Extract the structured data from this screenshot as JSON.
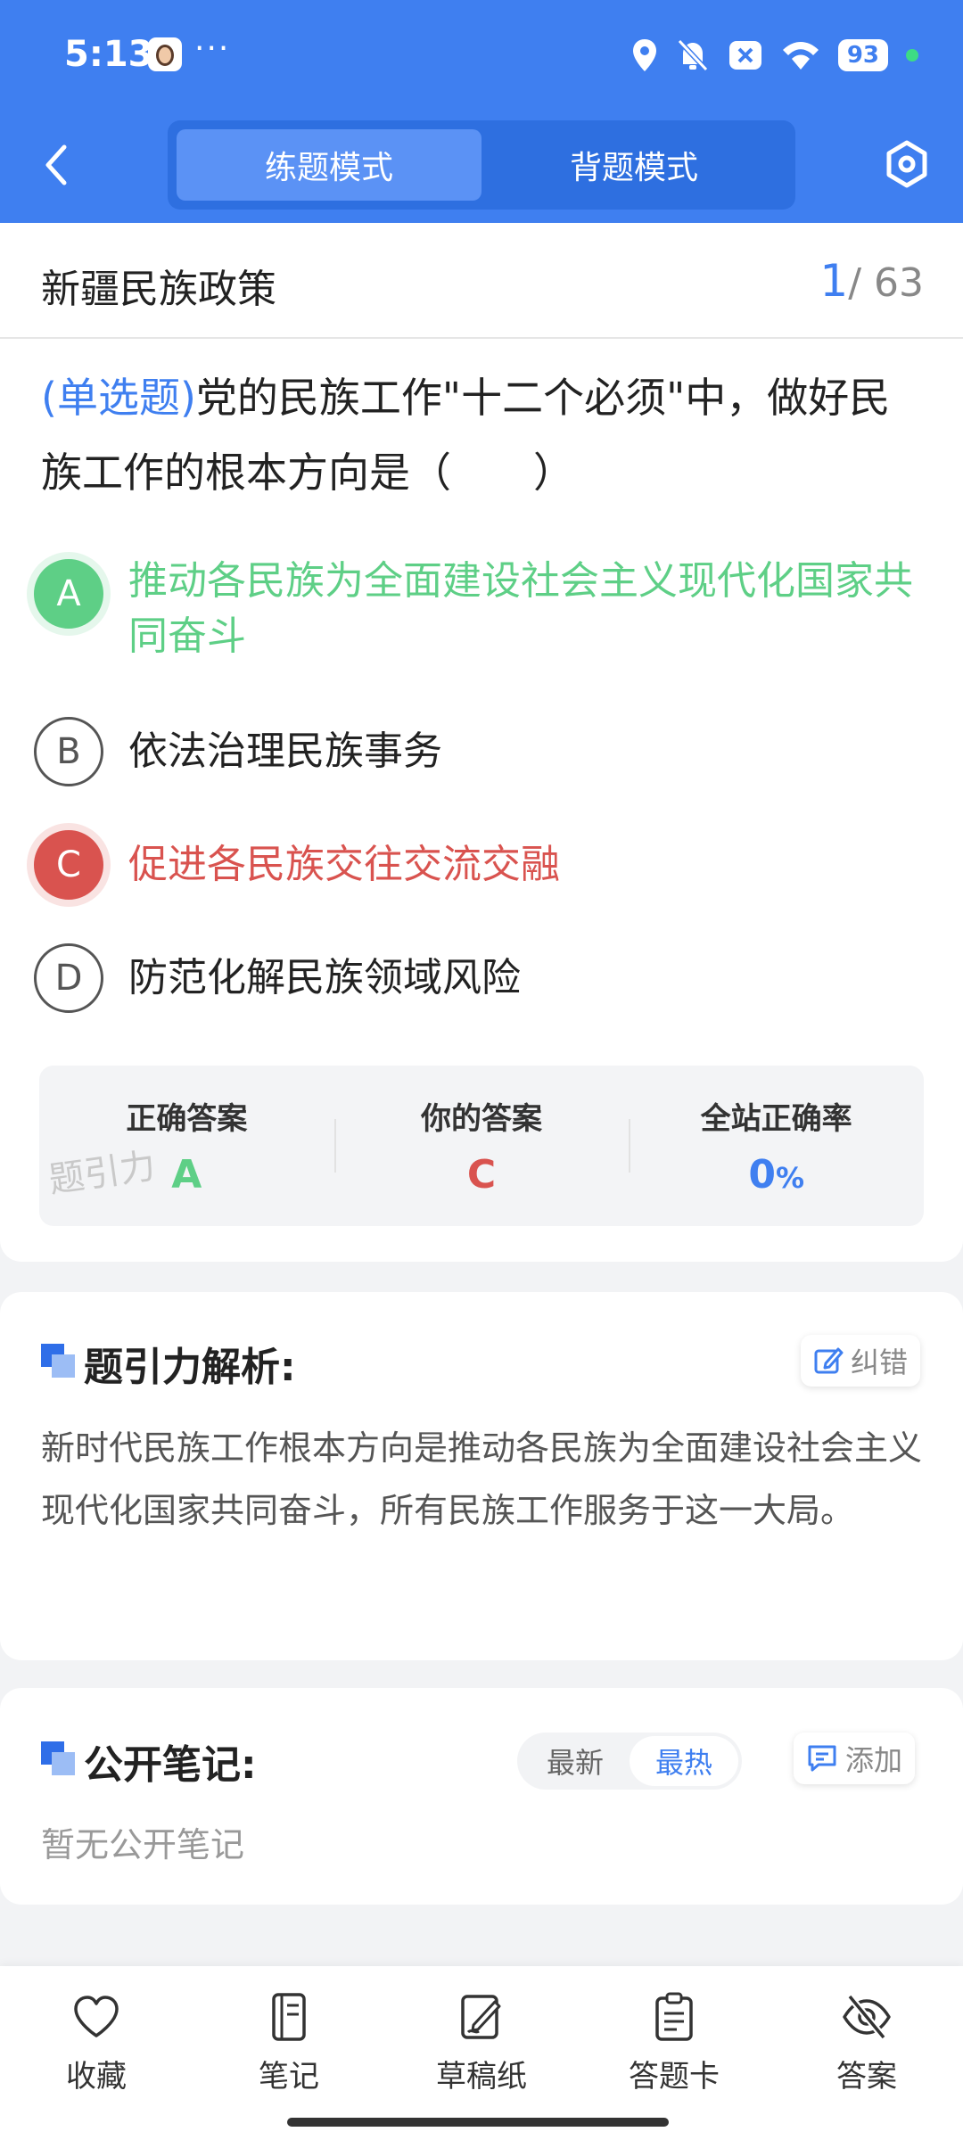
{
  "status_bar": {
    "time": "5:13",
    "more": "···",
    "battery": "93"
  },
  "header": {
    "tabs": [
      {
        "label": "练题模式",
        "active": true
      },
      {
        "label": "背题模式",
        "active": false
      }
    ],
    "icons": [
      "back-icon",
      "settings-icon"
    ]
  },
  "title_bar": {
    "category": "新疆民族政策",
    "current": "1",
    "total": "/ 63"
  },
  "question": {
    "type": "(单选题)",
    "text": "党的民族工作\"十二个必须\"中，做好民族工作的根本方向是（　　）",
    "options": [
      {
        "letter": "A",
        "text": "推动各民族为全面建设社会主义现代化国家共同奋斗",
        "state": "correct"
      },
      {
        "letter": "B",
        "text": "依法治理民族事务",
        "state": "normal"
      },
      {
        "letter": "C",
        "text": "促进各民族交往交流交融",
        "state": "wrong"
      },
      {
        "letter": "D",
        "text": "防范化解民族领域风险",
        "state": "normal"
      }
    ]
  },
  "result": {
    "correct_label": "正确答案",
    "correct_value": "A",
    "yours_label": "你的答案",
    "yours_value": "C",
    "rate_label": "全站正确率",
    "rate_value": "0",
    "rate_unit": "%",
    "watermark": "题引力"
  },
  "analysis": {
    "title": "题引力解析:",
    "report_label": "纠错",
    "text": "新时代民族工作根本方向是推动各民族为全面建设社会主义现代化国家共同奋斗，所有民族工作服务于这一大局。"
  },
  "notes": {
    "title": "公开笔记:",
    "sort_newest": "最新",
    "sort_hottest": "最热",
    "add_label": "添加",
    "empty": "暂无公开笔记"
  },
  "bottom_nav": [
    {
      "label": "收藏",
      "icon": "heart-icon"
    },
    {
      "label": "笔记",
      "icon": "notebook-icon"
    },
    {
      "label": "草稿纸",
      "icon": "draft-icon"
    },
    {
      "label": "答题卡",
      "icon": "answer-sheet-icon"
    },
    {
      "label": "答案",
      "icon": "eye-off-icon"
    }
  ],
  "colors": {
    "primary": "#3f7ff0",
    "correct": "#5ecf86",
    "wrong": "#d9534f"
  }
}
